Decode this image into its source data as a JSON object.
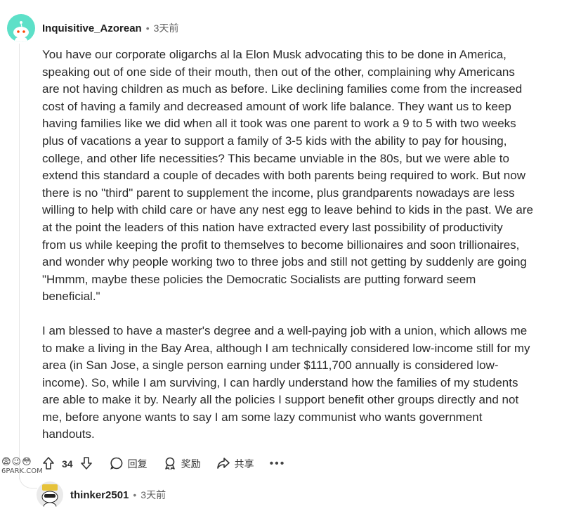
{
  "comment": {
    "username": "Inquisitive_Azorean",
    "separator": "•",
    "time": "3天前",
    "paragraph1_lines": [
      "You have our corporate oligarchs al la Elon Musk advocating this to be done in America,",
      "speaking out of one side of their mouth, then out of the other, complaining why Americans",
      "are not having children as much as before. Like declining families come from the increased",
      "cost of having a family and decreased amount of work life balance. They want us to keep",
      "having families like we did when all it took was one parent to work a 9 to 5 with two weeks",
      "plus of vacations a year to support a family of 3-5 kids with the ability to pay for housing,",
      "college, and other life necessities? This became unviable in the 80s, but we were able to",
      "extend this standard a couple of decades with both parents being required to work. But now",
      "there is no \"third\" parent to supplement the income, plus grandparents nowadays are less",
      "willing to help with child care or have any nest egg to leave behind to kids in the past. We are",
      "at the point the leaders of this nation have extracted every last possibility of productivity",
      "from us while keeping the profit to themselves to become billionaires and soon trillionaires,",
      "and wonder why people working two to three jobs and still not getting by suddenly are going",
      "\"Hmmm, maybe these policies the Democratic Socialists are putting forward seem",
      "beneficial.\""
    ],
    "paragraph2_lines": [
      "I am blessed to have a master's degree and a well-paying job with a union, which allows me",
      "to make a living in the Bay Area, although I am technically considered low-income still for my",
      "area (in San Jose, a single person earning under $111,700 annually is considered low-",
      "income). So, while I am surviving, I can hardly understand how the families of my students",
      "are able to make it by. Nearly all the policies I support benefit other groups directly and not",
      "me, before anyone wants to say I am some lazy communist who wants government",
      "handouts."
    ],
    "actions": {
      "vote_count": "34",
      "reply_label": "回复",
      "award_label": "奖励",
      "share_label": "共享",
      "more_label": "•••"
    }
  },
  "watermark": {
    "icons": "😨😉😳",
    "text": "6PARK.COM"
  },
  "reply": {
    "username": "thinker2501",
    "separator": "•",
    "time": "3天前"
  },
  "colors": {
    "avatar_bg": "#5de0c8",
    "text": "#2a2a2a",
    "meta": "#5f5f5f"
  }
}
